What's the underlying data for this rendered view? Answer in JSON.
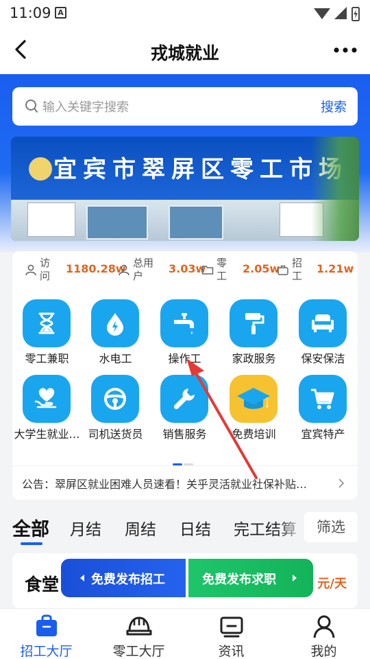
{
  "status_bar": {
    "time": "11:09",
    "notif_letter": "A"
  },
  "header": {
    "title": "戎城就业"
  },
  "search": {
    "placeholder": "输入关键字搜索",
    "button": "搜索"
  },
  "banner": {
    "sign_text": "宜宾市翠屏区零工市场"
  },
  "stats": [
    {
      "label": "访问",
      "value": "1180.28w",
      "icon": "person-icon"
    },
    {
      "label": "总用户",
      "value": "3.03w",
      "icon": "person-icon"
    },
    {
      "label": "零工",
      "value": "2.05w",
      "icon": "folder-icon"
    },
    {
      "label": "招工",
      "value": "1.21w",
      "icon": "briefcase-icon"
    }
  ],
  "categories": [
    {
      "label": "零工兼职",
      "icon": "hourglass-icon",
      "color": "#1aa6ee"
    },
    {
      "label": "水电工",
      "icon": "water-drop-icon",
      "color": "#1aa6ee"
    },
    {
      "label": "操作工",
      "icon": "faucet-icon",
      "color": "#1aa6ee"
    },
    {
      "label": "家政服务",
      "icon": "paint-roller-icon",
      "color": "#1aa6ee"
    },
    {
      "label": "保安保洁",
      "icon": "sofa-icon",
      "color": "#1aa6ee"
    },
    {
      "label": "大学生就业…",
      "icon": "heart-hand-icon",
      "color": "#1aa6ee"
    },
    {
      "label": "司机送货员",
      "icon": "steering-wheel-icon",
      "color": "#1aa6ee"
    },
    {
      "label": "销售服务",
      "icon": "wrench-icon",
      "color": "#1aa6ee"
    },
    {
      "label": "免费培训",
      "icon": "graduation-cap-icon",
      "color": "#f6c22f"
    },
    {
      "label": "宜宾特产",
      "icon": "shopping-cart-icon",
      "color": "#1aa6ee"
    }
  ],
  "notice": {
    "text": "公告：翠屏区就业困难人员速看！关乎灵活就业社保补贴…"
  },
  "tabs": [
    "全部",
    "月结",
    "周结",
    "日结",
    "完工结算"
  ],
  "filter_label": "筛选",
  "job_card": {
    "title": "食堂",
    "unit": "元/天"
  },
  "publish": {
    "recruit": "免费发布招工",
    "seek": "免费发布求职"
  },
  "bottom_nav": [
    {
      "label": "招工大厅",
      "icon": "bag-icon",
      "active": true
    },
    {
      "label": "零工大厅",
      "icon": "helmet-icon",
      "active": false
    },
    {
      "label": "资讯",
      "icon": "news-icon",
      "active": false
    },
    {
      "label": "我的",
      "icon": "user-icon",
      "active": false
    }
  ],
  "colors": {
    "primary": "#1a5ef0",
    "accent_orange": "#e3641e",
    "icon_blue": "#1aa6ee",
    "green": "#1ec56a",
    "arrow_red": "#e53935"
  }
}
